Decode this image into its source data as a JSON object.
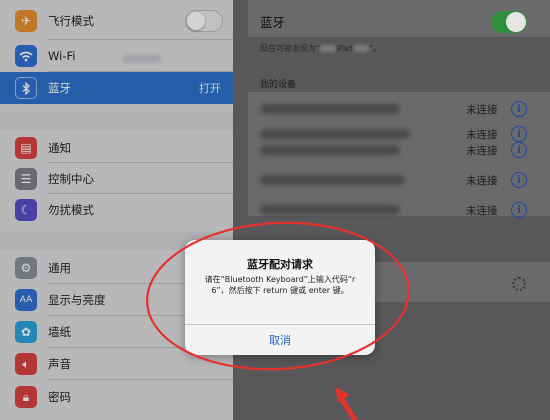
{
  "sidebar": {
    "items": [
      {
        "label": "飞行模式",
        "icon": "airplane-icon",
        "color": "#e4912e"
      },
      {
        "label": "Wi-Fi",
        "icon": "wifi-icon",
        "color": "#2f6fd0"
      },
      {
        "label": "蓝牙",
        "icon": "bluetooth-icon",
        "color": "#2f6fd0",
        "status": "打开"
      },
      {
        "label": "通知",
        "icon": "notifications-icon",
        "color": "#d84141"
      },
      {
        "label": "控制中心",
        "icon": "control-center-icon",
        "color": "#7c7f86"
      },
      {
        "label": "勿扰模式",
        "icon": "moon-icon",
        "color": "#5a4cc9"
      },
      {
        "label": "通用",
        "icon": "gear-icon",
        "color": "#8b8e95"
      },
      {
        "label": "显示与亮度",
        "icon": "display-brightness-icon",
        "color": "#2f6fd0"
      },
      {
        "label": "墙纸",
        "icon": "wallpaper-icon",
        "color": "#2aa3d8"
      },
      {
        "label": "声音",
        "icon": "sound-icon",
        "color": "#d84141"
      },
      {
        "label": "密码",
        "icon": "lock-icon",
        "color": "#d84141"
      }
    ]
  },
  "bluetooth": {
    "title": "蓝牙",
    "discover_prefix": "现在可被发现为“",
    "discover_mid": "iPad",
    "discover_suffix": "”。",
    "my_devices": "我的设备",
    "devices": [
      {
        "status": "未连接"
      },
      {
        "status": "未连接"
      },
      {
        "status": "未连接"
      },
      {
        "status": "未连接"
      },
      {
        "status": "未连接"
      }
    ]
  },
  "alert": {
    "title": "蓝牙配对请求",
    "message": "请在“Bluetooth Keyboard”上输入代码“r    6”，然后按下 return 键或 enter 键。",
    "cancel": "取消"
  },
  "colors": {
    "selected": "#2d70c9",
    "toggle_on": "#2f8f3a",
    "annotation": "#e5322d",
    "link": "#2563cf"
  }
}
